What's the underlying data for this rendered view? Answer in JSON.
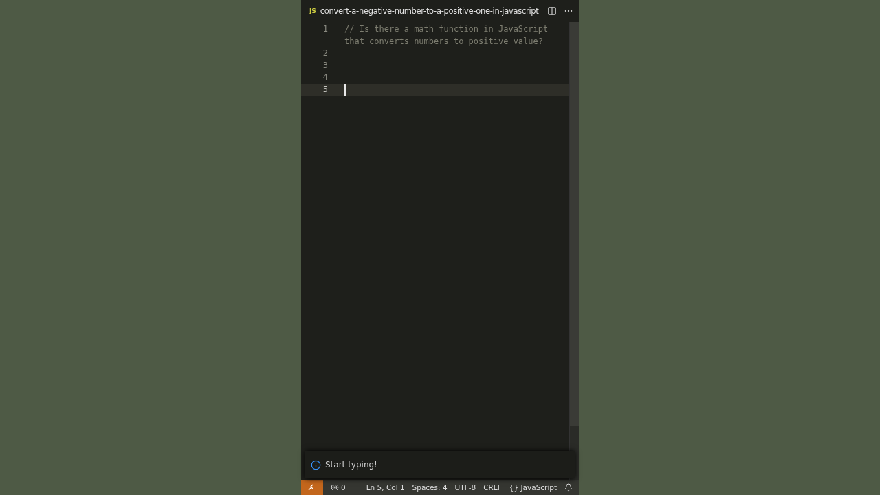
{
  "tab": {
    "icon_text": "JS",
    "title": "convert-a-negative-number-to-a-positive-one-in-javascript"
  },
  "lines": [
    {
      "number": "1",
      "text": "// Is there a math function in JavaScript that converts numbers to positive value?",
      "current": false
    },
    {
      "number": "2",
      "current": false
    },
    {
      "number": "3",
      "current": false
    },
    {
      "number": "4",
      "current": false
    },
    {
      "number": "5",
      "current": true
    }
  ],
  "notification": {
    "message": "Start typing!"
  },
  "status_bar": {
    "ports": "0",
    "position": "Ln 5, Col 1",
    "indent": "Spaces: 4",
    "encoding": "UTF-8",
    "eol": "CRLF",
    "language_icon": "{}",
    "language": "JavaScript"
  }
}
